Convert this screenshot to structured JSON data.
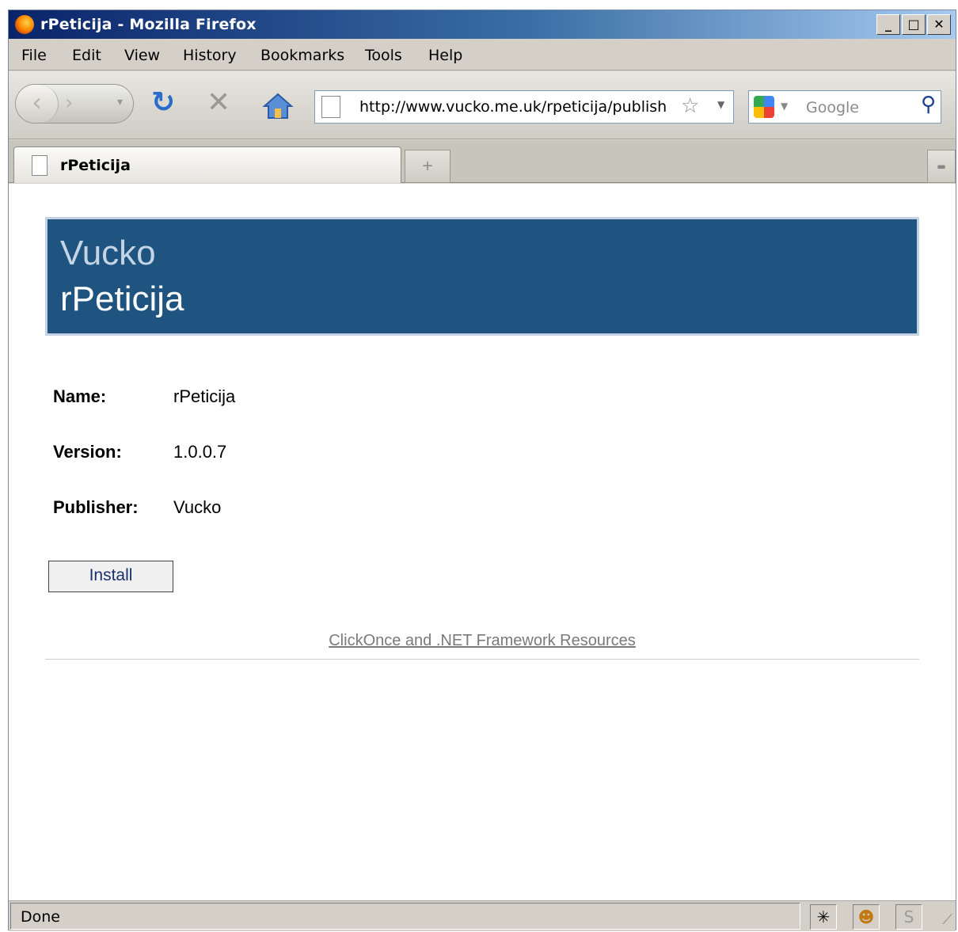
{
  "window": {
    "title": "rPeticija - Mozilla Firefox",
    "controls": {
      "minimize": "_",
      "maximize": "□",
      "close": "✕"
    }
  },
  "menubar": {
    "items": [
      "File",
      "Edit",
      "View",
      "History",
      "Bookmarks",
      "Tools",
      "Help"
    ]
  },
  "navbar": {
    "url": "http://www.vucko.me.uk/rpeticija/publish",
    "search": {
      "engine_icon": "google-icon",
      "placeholder": "Google"
    }
  },
  "tabs": [
    {
      "label": "rPeticija",
      "active": true
    }
  ],
  "page": {
    "banner": {
      "publisher": "Vucko",
      "app_name": "rPeticija",
      "color": "#1f5480"
    },
    "info": [
      {
        "label": "Name:",
        "value": "rPeticija"
      },
      {
        "label": "Version:",
        "value": "1.0.0.7"
      },
      {
        "label": "Publisher:",
        "value": "Vucko"
      }
    ],
    "install_label": "Install",
    "resources_link": "ClickOnce and .NET Framework Resources"
  },
  "statusbar": {
    "text": "Done",
    "icons": [
      "bug-icon",
      "greasemonkey-icon",
      "stylish-icon"
    ]
  }
}
